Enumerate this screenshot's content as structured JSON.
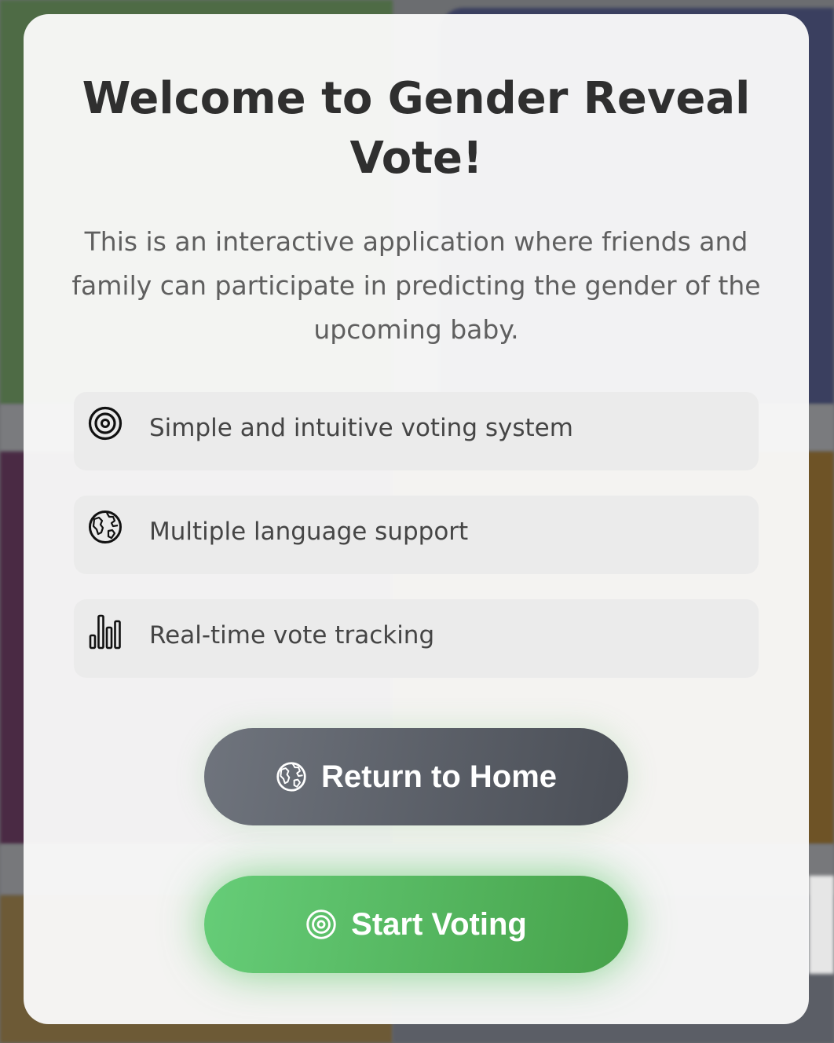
{
  "modal": {
    "title": "Welcome to Gender Reveal Vote!",
    "intro": "This is an interactive application where friends and family can participate in predicting the gender of the upcoming baby."
  },
  "features": [
    {
      "icon": "target-icon",
      "label": "Simple and intuitive voting system"
    },
    {
      "icon": "globe-icon",
      "label": "Multiple language support"
    },
    {
      "icon": "bar-chart-icon",
      "label": "Real-time vote tracking"
    }
  ],
  "buttons": {
    "home_label": "Return to Home",
    "home_icon": "globe-icon",
    "start_label": "Start Voting",
    "start_icon": "target-icon"
  },
  "colors": {
    "start_button": "#55b862",
    "home_button": "#5c6068",
    "title_text": "#2f2f2f"
  }
}
